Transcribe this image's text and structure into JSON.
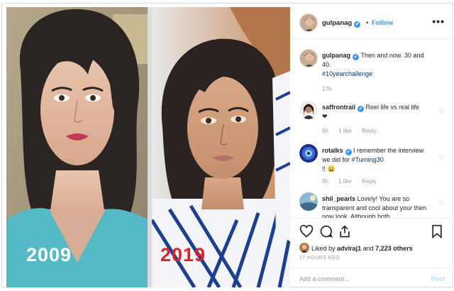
{
  "post": {
    "year_left": "2009",
    "year_right": "2019"
  },
  "header": {
    "username": "gulpanag",
    "verified_badge": "✔",
    "dot": "•",
    "follow_label": "Follow",
    "more_label": "•••"
  },
  "caption": {
    "username": "gulpanag",
    "text": "Then and now. 30 and 40.",
    "hashtag": "#10yearchallenge",
    "time": "17h"
  },
  "comments": [
    {
      "username": "saffrontrail",
      "verified": true,
      "text": "Reel life vs real life",
      "emoji": "❤",
      "time": "6h",
      "likes": "1 like",
      "reply": "Reply"
    },
    {
      "username": "rotalks",
      "verified": true,
      "text": "I remember the interview we did for",
      "hashtag": "#Turning30",
      "tail": "!! 😀",
      "time": "9h",
      "likes": "1 like",
      "reply": "Reply"
    },
    {
      "username": "shil_pearls",
      "verified": false,
      "text": "Lovely! You are so transparent and cool about your then now look. Although both"
    }
  ],
  "actions": {
    "icons": [
      "heart-icon",
      "comment-icon",
      "share-icon",
      "bookmark-icon"
    ],
    "liked_by_prefix": "Liked by",
    "liked_by_user": "adviraj1",
    "liked_by_and": "and",
    "liked_by_count": "7,223 others",
    "posted_ago": "17 HOURS AGO"
  },
  "add_comment": {
    "placeholder": "Add a comment...",
    "post_label": "Post"
  },
  "colors": {
    "link_blue": "#3897f0",
    "year_red": "#e32027",
    "hashtag": "#003569",
    "border": "#dbdbdb"
  }
}
